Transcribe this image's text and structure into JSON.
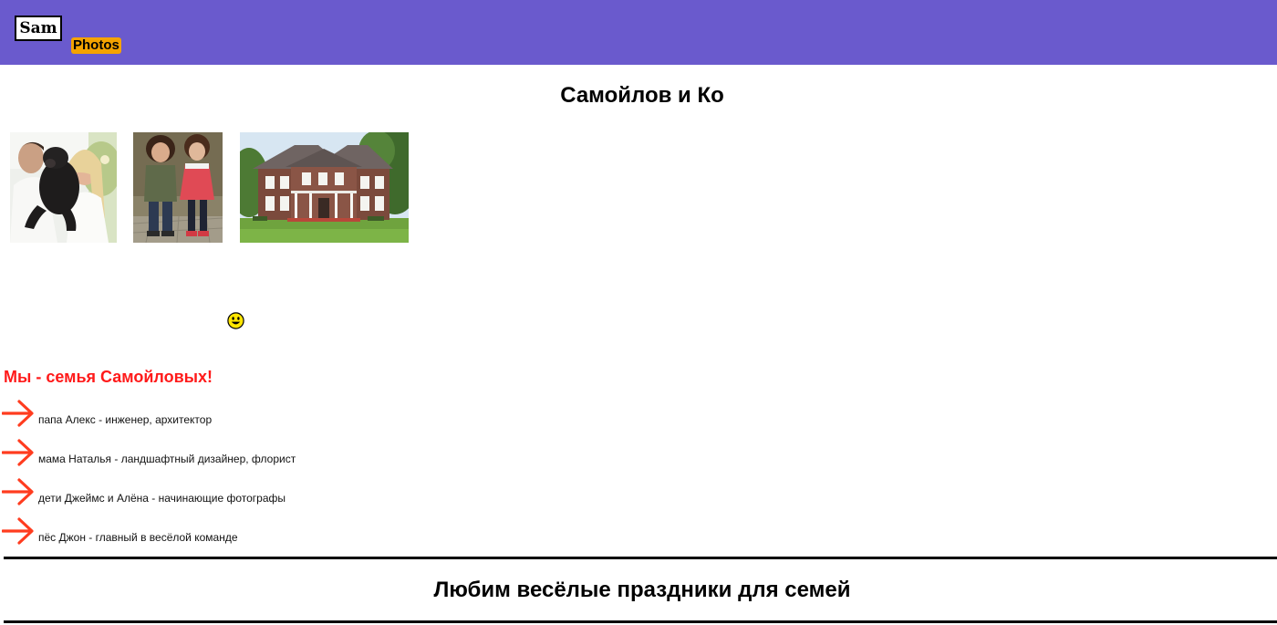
{
  "header": {
    "logo_text": "Sam",
    "logo_tag": "Photos",
    "bar_color": "#6a5acd",
    "tag_color": "#f5a300"
  },
  "main": {
    "title": "Самойлов и Ко",
    "photos": [
      {
        "subject": "couple-with-dog-photo"
      },
      {
        "subject": "children-photo"
      },
      {
        "subject": "house-photo"
      }
    ],
    "emoji_icon": "smiley-icon",
    "family": {
      "heading": "Мы - семья Самойловых!",
      "heading_color": "#ff1a1a",
      "bullet_icon": "arrow-right-icon",
      "bullet_color": "#ff3c1f",
      "members": [
        "папа Алекс - инженер, архитектор",
        "мама Наталья - ландшафтный дизайнер, флорист",
        "дети Джеймс и Алёна - начинающие фотографы",
        "пёс Джон - главный в весёлой команде"
      ]
    },
    "holiday_title": "Любим весёлые праздники для семей"
  }
}
